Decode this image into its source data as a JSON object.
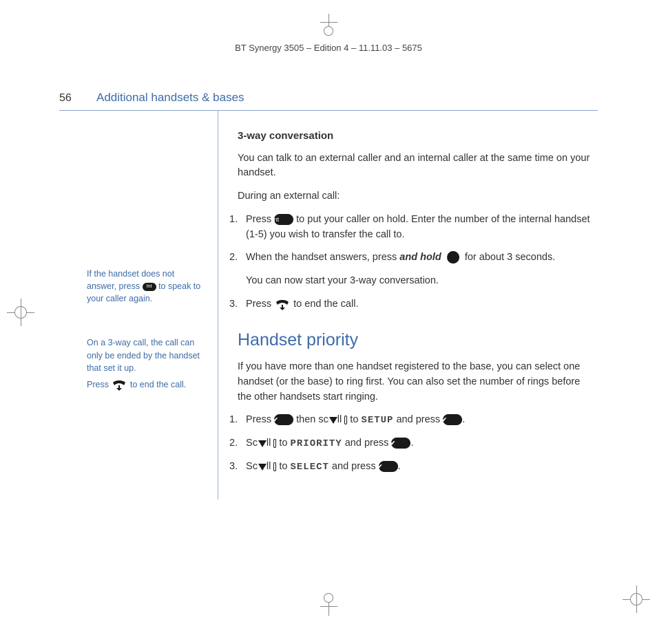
{
  "header": "BT Synergy 3505 – Edition 4 – 11.11.03 – 5675",
  "page_number": "56",
  "section": "Additional handsets & bases",
  "sidebar": {
    "note1a": "If the handset does not answer, press ",
    "note1b": " to speak to your caller again.",
    "note2": "On a 3-way call, the call can only be ended by the handset that set it up.",
    "note3a": "Press ",
    "note3b": " to end the call."
  },
  "main": {
    "h3": "3-way conversation",
    "p1": "You can talk to an external caller and an internal caller at the same time on your handset.",
    "p2": "During an external call:",
    "step1a": "Press ",
    "step1b": " to put your caller on hold. Enter the number of the internal handset (1-5) you wish to transfer the call to.",
    "step2a": "When the handset answers, press ",
    "step2_hold": "and hold",
    "step2b": " for about 3 seconds.",
    "p3": "You can now start your 3-way conversation.",
    "step3a": "Press ",
    "step3b": " to end the call.",
    "h2": "Handset priority",
    "p4": "If you have more than one handset registered to the base, you can select one handset (or the base) to ring first. You can also set the number of rings before the other handsets start ringing.",
    "hp1a": "Press ",
    "hp1b": " then scroll ",
    "hp1c": " to ",
    "hp1_menu": "SETUP",
    "hp1d": " and press ",
    "hp2a": "Scroll ",
    "hp2b": " to ",
    "hp2_menu": "PRIORITY",
    "hp2c": " and press ",
    "hp3a": "Scroll ",
    "hp3b": " to ",
    "hp3_menu": "SELECT",
    "hp3c": " and press ",
    "period": "."
  },
  "labels": {
    "int": "Int"
  }
}
